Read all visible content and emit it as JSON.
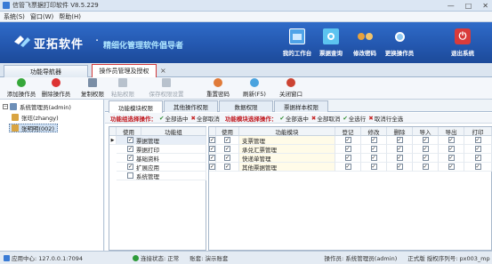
{
  "app": {
    "title": "信管飞票据打印软件 V8.5.229",
    "window_controls": [
      "—",
      "□",
      "✕"
    ]
  },
  "menu": [
    "系统(S)",
    "窗口(W)",
    "帮助(H)"
  ],
  "banner": {
    "logo": "亚拓软件",
    "slogan": "精细化管理软件倡导者",
    "buttons": [
      {
        "label": "我的工作台",
        "icon": "monitor-icon",
        "color": "#4fa3e8"
      },
      {
        "label": "票据查询",
        "icon": "receipt-search-icon",
        "color": "#5cc3f0"
      },
      {
        "label": "修改密码",
        "icon": "users-key-icon",
        "color": "#e8a23c"
      },
      {
        "label": "更换操作员",
        "icon": "user-switch-icon",
        "color": "#8fc8f2"
      },
      {
        "label": "退出系统",
        "icon": "power-icon",
        "color": "#d93b3b"
      }
    ]
  },
  "tabs": [
    {
      "label": "功能导航器",
      "active": false
    },
    {
      "label": "操作员管理及授权",
      "active": true
    }
  ],
  "toolbar": [
    {
      "label": "添加操作员",
      "icon": "add-icon",
      "color": "#36a73a",
      "enabled": true
    },
    {
      "label": "删除操作员",
      "icon": "delete-icon",
      "color": "#d33",
      "enabled": true
    },
    {
      "label": "复制权限",
      "icon": "copy-icon",
      "color": "#7a8ea6",
      "enabled": true
    },
    {
      "label": "粘贴权限",
      "icon": "paste-icon",
      "color": "#b8c2cd",
      "enabled": false
    },
    {
      "label": "保存权限设置",
      "icon": "save-icon",
      "color": "#b8c2cd",
      "enabled": false
    },
    {
      "label": "重置密码",
      "icon": "reset-password-icon",
      "color": "#e07b39",
      "enabled": true
    },
    {
      "label": "刷新(F5)",
      "icon": "refresh-icon",
      "color": "#4aa3df",
      "enabled": true
    },
    {
      "label": "关闭窗口",
      "icon": "close-window-icon",
      "color": "#c43",
      "enabled": true
    }
  ],
  "operators": [
    {
      "label": "系统管理员(admin)",
      "selected": false
    },
    {
      "label": "张珏(zhangy)",
      "selected": false
    },
    {
      "label": "张明明(002)",
      "selected": true
    }
  ],
  "subtabs": [
    "功能模块权限",
    "其他操作权限",
    "数据权限",
    "票据样本权限"
  ],
  "opbar": {
    "group_label": "功能组选择操作：",
    "group_select_all": "全部选中",
    "group_cancel_all": "全部取消",
    "module_label": "功能模块选择操作：",
    "module_select_all": "全部选中",
    "module_cancel_all": "全部取消",
    "select_row": "全选行",
    "cancel_row": "取消行全选"
  },
  "group_grid": {
    "headers": [
      "使用",
      "功能组"
    ],
    "rows": [
      {
        "label": "票据管理",
        "checked": true
      },
      {
        "label": "票据打印",
        "checked": true
      },
      {
        "label": "基础资料",
        "checked": true
      },
      {
        "label": "扩展应用",
        "checked": true
      },
      {
        "label": "系统管理",
        "checked": false
      }
    ]
  },
  "module_grid": {
    "headers": [
      "使用",
      "功能模块",
      "登记",
      "修改",
      "删除",
      "导入",
      "导出",
      "打印"
    ],
    "rows": [
      {
        "label": "支票管理",
        "checks": [
          true,
          true,
          true,
          true,
          true,
          true,
          true
        ]
      },
      {
        "label": "承兑汇票管理",
        "checks": [
          true,
          true,
          true,
          true,
          true,
          true,
          true
        ]
      },
      {
        "label": "快递单管理",
        "checks": [
          true,
          true,
          true,
          true,
          true,
          true,
          true
        ]
      },
      {
        "label": "其他票据管理",
        "checks": [
          true,
          true,
          true,
          true,
          true,
          true,
          true
        ]
      }
    ]
  },
  "status": {
    "server": "应用中心: 127.0.0.1:7094",
    "conn": "连接状态: 正常",
    "account": "账套: 演示账套",
    "operator": "操作员: 系统管理员(admin)",
    "license": "正式版 授权序列号: px003_mp"
  }
}
